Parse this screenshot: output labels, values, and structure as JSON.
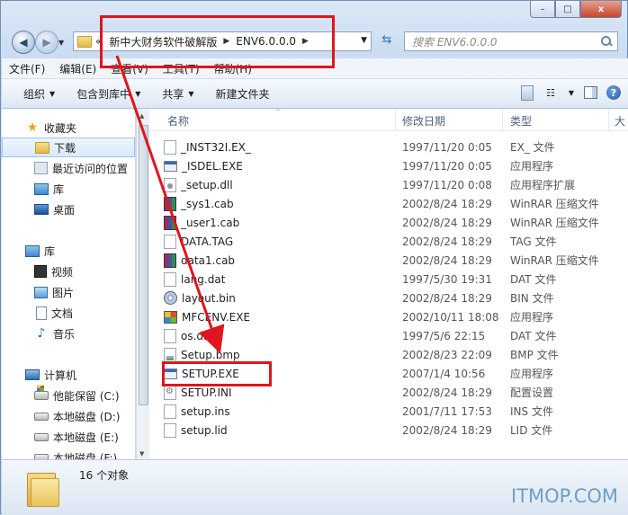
{
  "window": {
    "caption_buttons": [
      "–",
      "□",
      "x"
    ]
  },
  "address": {
    "crumbs": [
      "«",
      "新中大财务软件破解版",
      "ENV6.0.0.0"
    ]
  },
  "search": {
    "placeholder": "搜索 ENV6.0.0.0"
  },
  "menu": [
    "文件(F)",
    "编辑(E)",
    "查看(V)",
    "工具(T)",
    "帮助(H)"
  ],
  "toolbar": {
    "organize": "组织",
    "include_library": "包含到库中",
    "share": "共享",
    "new_folder": "新建文件夹"
  },
  "nav": {
    "favorites": "收藏夹",
    "downloads": "下载",
    "recent": "最近访问的位置",
    "library_fav": "库",
    "desktop": "桌面",
    "libraries": "库",
    "videos": "视频",
    "pictures": "图片",
    "documents": "文档",
    "music": "音乐",
    "computer": "计算机",
    "drive_c": "他能保留 (C:)",
    "drive_d": "本地磁盘 (D:)",
    "drive_e": "本地磁盘 (E:)",
    "drive_f": "本地磁盘 (F:)"
  },
  "columns": {
    "name": "名称",
    "date": "修改日期",
    "type": "类型",
    "extra": "大"
  },
  "files": [
    {
      "name": "_INST32I.EX_",
      "date": "1997/11/20 0:05",
      "type": "EX_ 文件",
      "icon": "blank-file-icon"
    },
    {
      "name": "_ISDEL.EXE",
      "date": "1997/11/20 0:05",
      "type": "应用程序",
      "icon": "exe-icon"
    },
    {
      "name": "_setup.dll",
      "date": "1997/11/20 0:08",
      "type": "应用程序扩展",
      "icon": "dll-icon"
    },
    {
      "name": "_sys1.cab",
      "date": "2002/8/24 18:29",
      "type": "WinRAR 压缩文件",
      "icon": "winrar-icon"
    },
    {
      "name": "_user1.cab",
      "date": "2002/8/24 18:29",
      "type": "WinRAR 压缩文件",
      "icon": "winrar-icon"
    },
    {
      "name": "DATA.TAG",
      "date": "2002/8/24 18:29",
      "type": "TAG 文件",
      "icon": "blank-file-icon"
    },
    {
      "name": "data1.cab",
      "date": "2002/8/24 18:29",
      "type": "WinRAR 压缩文件",
      "icon": "winrar-icon"
    },
    {
      "name": "lang.dat",
      "date": "1997/5/30 19:31",
      "type": "DAT 文件",
      "icon": "blank-file-icon"
    },
    {
      "name": "layout.bin",
      "date": "2002/8/24 18:29",
      "type": "BIN 文件",
      "icon": "disc-icon"
    },
    {
      "name": "MFCENV.EXE",
      "date": "2002/10/11 18:08",
      "type": "应用程序",
      "icon": "mfc-app-icon"
    },
    {
      "name": "os.dat",
      "date": "1997/5/6 22:15",
      "type": "DAT 文件",
      "icon": "blank-file-icon"
    },
    {
      "name": "Setup.bmp",
      "date": "2002/8/23 22:09",
      "type": "BMP 文件",
      "icon": "bitmap-icon"
    },
    {
      "name": "SETUP.EXE",
      "date": "2007/1/4 10:56",
      "type": "应用程序",
      "icon": "exe-icon"
    },
    {
      "name": "SETUP.INI",
      "date": "2002/8/24 18:29",
      "type": "配置设置",
      "icon": "ini-icon"
    },
    {
      "name": "setup.ins",
      "date": "2001/7/11 17:53",
      "type": "INS 文件",
      "icon": "blank-file-icon"
    },
    {
      "name": "setup.lid",
      "date": "2002/8/24 18:29",
      "type": "LID 文件",
      "icon": "blank-file-icon"
    }
  ],
  "status": {
    "count": "16 个对象"
  },
  "watermark": "ITMOP.COM",
  "colors": {
    "annotation_red": "#e0151d",
    "watermark_blue": "#6f9ec8"
  }
}
